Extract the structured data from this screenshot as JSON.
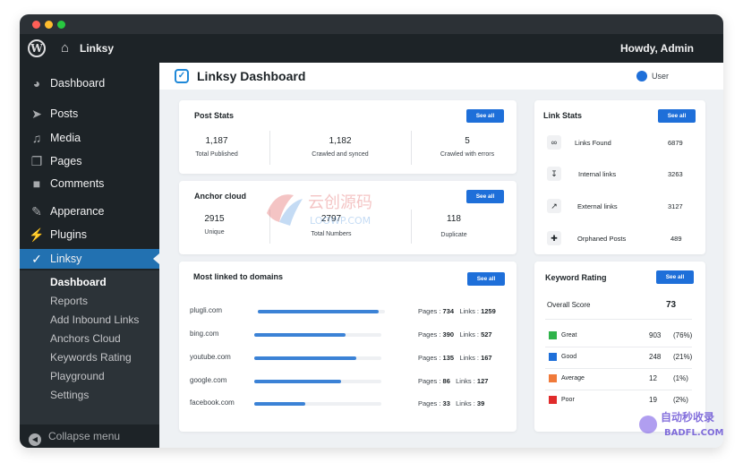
{
  "topbar": {
    "site_name": "Linksy",
    "howdy": "Howdy, Admin"
  },
  "sidebar": {
    "items": [
      {
        "label": "Dashboard",
        "icon": "gauge-icon"
      },
      {
        "label": "Posts",
        "icon": "pin-icon"
      },
      {
        "label": "Media",
        "icon": "media-icon"
      },
      {
        "label": "Pages",
        "icon": "page-icon"
      },
      {
        "label": "Comments",
        "icon": "comment-icon"
      },
      {
        "label": "Apperance",
        "icon": "brush-icon"
      },
      {
        "label": "Plugins",
        "icon": "plug-icon"
      },
      {
        "label": "Linksy",
        "icon": "linksy-icon"
      }
    ],
    "submenu": [
      "Dashboard",
      "Reports",
      "Add Inbound Links",
      "Anchors Cloud",
      "Keywords Rating",
      "Playground",
      "Settings"
    ],
    "collapse": "Collapse menu"
  },
  "header": {
    "title": "Linksy Dashboard",
    "user": "User"
  },
  "see_all": "See all",
  "post_stats": {
    "title": "Post Stats",
    "stats": [
      {
        "value": "1,187",
        "label": "Total Published"
      },
      {
        "value": "1,182",
        "label": "Crawled and synced"
      },
      {
        "value": "5",
        "label": "Crawled with errors"
      }
    ]
  },
  "anchor_cloud": {
    "title": "Anchor cloud",
    "stats": [
      {
        "value": "2915",
        "label": "Unique"
      },
      {
        "value": "2797",
        "label": "Total Numbers"
      },
      {
        "value": "118",
        "label": "Duplicate"
      }
    ]
  },
  "domains": {
    "title": "Most linked to domains",
    "pages_label": "Pages :",
    "links_label": "Links :",
    "rows": [
      {
        "name": "plugli.com",
        "pages": "734",
        "links": "1259",
        "fill": 0.95
      },
      {
        "name": "bing.com",
        "pages": "390",
        "links": "527",
        "fill": 0.72
      },
      {
        "name": "youtube.com",
        "pages": "135",
        "links": "167",
        "fill": 0.8
      },
      {
        "name": "google.com",
        "pages": "86",
        "links": "127",
        "fill": 0.68
      },
      {
        "name": "facebook.com",
        "pages": "33",
        "links": "39",
        "fill": 0.4
      }
    ]
  },
  "link_stats": {
    "title": "Link Stats",
    "rows": [
      {
        "label": "Links Found",
        "value": "6879",
        "icon": "link-icon"
      },
      {
        "label": "Internal links",
        "value": "3263",
        "icon": "internal-link-icon"
      },
      {
        "label": "External links",
        "value": "3127",
        "icon": "external-link-icon"
      },
      {
        "label": "Orphaned Posts",
        "value": "489",
        "icon": "orphan-icon"
      }
    ]
  },
  "keyword_rating": {
    "title": "Keyword Rating",
    "overall_label": "Overall Score",
    "overall_value": "73",
    "rows": [
      {
        "label": "Great",
        "count": "903",
        "pct": "(76%)",
        "color": "#2fb34a"
      },
      {
        "label": "Good",
        "count": "248",
        "pct": "(21%)",
        "color": "#1e6fd9"
      },
      {
        "label": "Average",
        "count": "12",
        "pct": "(1%)",
        "color": "#f07a3a"
      },
      {
        "label": "Poor",
        "count": "19",
        "pct": "(2%)",
        "color": "#e02b2b"
      }
    ]
  },
  "watermark": {
    "cn1": "云创源码",
    "en1": "LOOWP.COM",
    "cn2": "自动秒收录",
    "en2": "BADFL.COM"
  }
}
